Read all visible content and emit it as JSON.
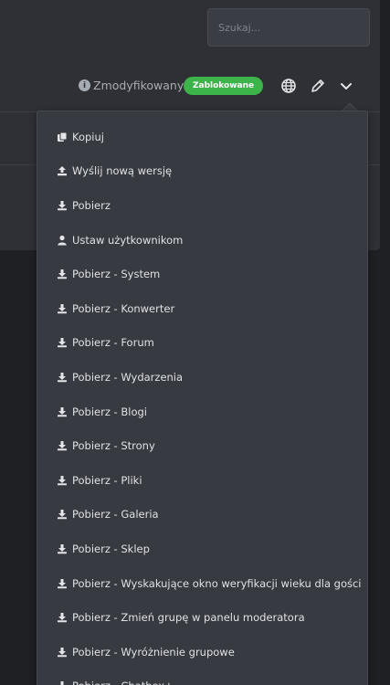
{
  "search": {
    "placeholder": "Szukaj..."
  },
  "status": {
    "modified_label": "Zmodyfikowany",
    "locked_badge": "Zablokowane",
    "badge_color": "#3cb44a"
  },
  "toolbar": {
    "icons": [
      "globe-icon",
      "pencil-icon",
      "chevron-down-icon"
    ]
  },
  "menu": {
    "items": [
      {
        "label": "Kopiuj",
        "icon": "copy-icon"
      },
      {
        "label": "Wyślij nową wersję",
        "icon": "upload-icon"
      },
      {
        "label": "Pobierz",
        "icon": "download-icon"
      },
      {
        "label": "Ustaw użytkownikom",
        "icon": "user-icon"
      },
      {
        "label": "Pobierz - System",
        "icon": "download-icon"
      },
      {
        "label": "Pobierz - Konwerter",
        "icon": "download-icon"
      },
      {
        "label": "Pobierz - Forum",
        "icon": "download-icon"
      },
      {
        "label": "Pobierz - Wydarzenia",
        "icon": "download-icon"
      },
      {
        "label": "Pobierz - Blogi",
        "icon": "download-icon"
      },
      {
        "label": "Pobierz - Strony",
        "icon": "download-icon"
      },
      {
        "label": "Pobierz - Pliki",
        "icon": "download-icon"
      },
      {
        "label": "Pobierz - Galeria",
        "icon": "download-icon"
      },
      {
        "label": "Pobierz - Sklep",
        "icon": "download-icon"
      },
      {
        "label": "Pobierz - Wyskakujące okno weryfikacji wieku dla gości",
        "icon": "download-icon"
      },
      {
        "label": "Pobierz - Zmień grupę w panelu moderatora",
        "icon": "download-icon"
      },
      {
        "label": "Pobierz - Wyróżnienie grupowe",
        "icon": "download-icon"
      },
      {
        "label": "Pobierz - Chatbox+",
        "icon": "download-icon"
      }
    ]
  }
}
